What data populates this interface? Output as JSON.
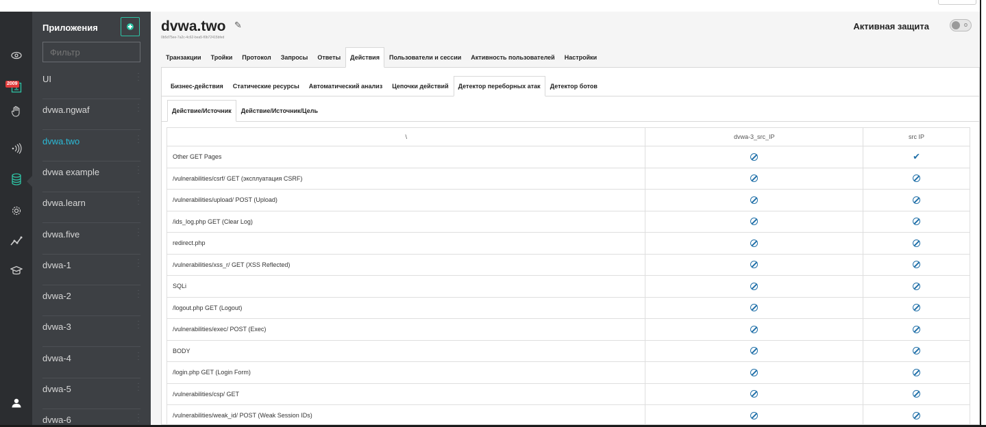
{
  "rail": {
    "badge": "2009",
    "icons": [
      "eye-icon",
      "alert-icon",
      "hand-icon",
      "signal-icon",
      "database-icon",
      "gear-icon",
      "graph-icon",
      "graduation-icon",
      "user-icon"
    ]
  },
  "apps": {
    "title": "Приложения",
    "filter_placeholder": "Фильтр",
    "items": [
      {
        "label": "UI"
      },
      {
        "label": "dvwa.ngwaf"
      },
      {
        "label": "dvwa.two"
      },
      {
        "label": "dvwa example"
      },
      {
        "label": "dvwa.learn"
      },
      {
        "label": "dvwa.five"
      },
      {
        "label": "dvwa-1"
      },
      {
        "label": "dvwa-2"
      },
      {
        "label": "dvwa-3"
      },
      {
        "label": "dvwa-4"
      },
      {
        "label": "dvwa-5"
      },
      {
        "label": "dvwa-6"
      }
    ],
    "active_index": 2
  },
  "header": {
    "title": "dvwa.two",
    "id": "0b5d75ee-7a2c-4c62-bea5-f0b72415bfed",
    "protection_label": "Активная защита",
    "toggle_text": "o"
  },
  "tabs_main": [
    "Транзакции",
    "Тройки",
    "Протокол",
    "Запросы",
    "Ответы",
    "Действия",
    "Пользователи и сессии",
    "Активность пользователей",
    "Настройки"
  ],
  "tabs_sub": [
    "Бизнес-действия",
    "Статические ресурсы",
    "Автоматический анализ",
    "Цепочки действий",
    "Детектор переборных атак",
    "Детектор ботов"
  ],
  "tabs_sub2": [
    "Действие/Источник",
    "Действие/Источник/Цель"
  ],
  "table": {
    "headers": [
      "\\",
      "dvwa-3_src_IP",
      "src IP"
    ],
    "rows": [
      {
        "name": "Other GET Pages",
        "col1": "ban",
        "col2": "check"
      },
      {
        "name": "/vulnerabilities/csrf/ GET (эксплуатация CSRF)",
        "col1": "ban",
        "col2": "ban"
      },
      {
        "name": "/vulnerabilities/upload/ POST (Upload)",
        "col1": "ban",
        "col2": "ban"
      },
      {
        "name": "/ids_log.php GET (Clear Log)",
        "col1": "ban",
        "col2": "ban"
      },
      {
        "name": "redirect.php",
        "col1": "ban",
        "col2": "ban"
      },
      {
        "name": "/vulnerabilities/xss_r/ GET (XSS Reflected)",
        "col1": "ban",
        "col2": "ban"
      },
      {
        "name": "SQLi",
        "col1": "ban",
        "col2": "ban"
      },
      {
        "name": "/logout.php GET (Logout)",
        "col1": "ban",
        "col2": "ban"
      },
      {
        "name": "/vulnerabilities/exec/ POST (Exec)",
        "col1": "ban",
        "col2": "ban"
      },
      {
        "name": "BODY",
        "col1": "ban",
        "col2": "ban"
      },
      {
        "name": "/login.php GET (Login Form)",
        "col1": "ban",
        "col2": "ban"
      },
      {
        "name": "/vulnerabilities/csp/ GET",
        "col1": "ban",
        "col2": "ban"
      },
      {
        "name": "/vulnerabilities/weak_id/ POST (Weak Session IDs)",
        "col1": "ban",
        "col2": "ban"
      }
    ]
  },
  "colors": {
    "rail": "#2b2d30",
    "sidebar": "#3d4044",
    "accent": "#2ec4a5",
    "active_app": "#2bbbd8",
    "icon_blue": "#1f6fa8",
    "badge": "#e23b3b"
  }
}
